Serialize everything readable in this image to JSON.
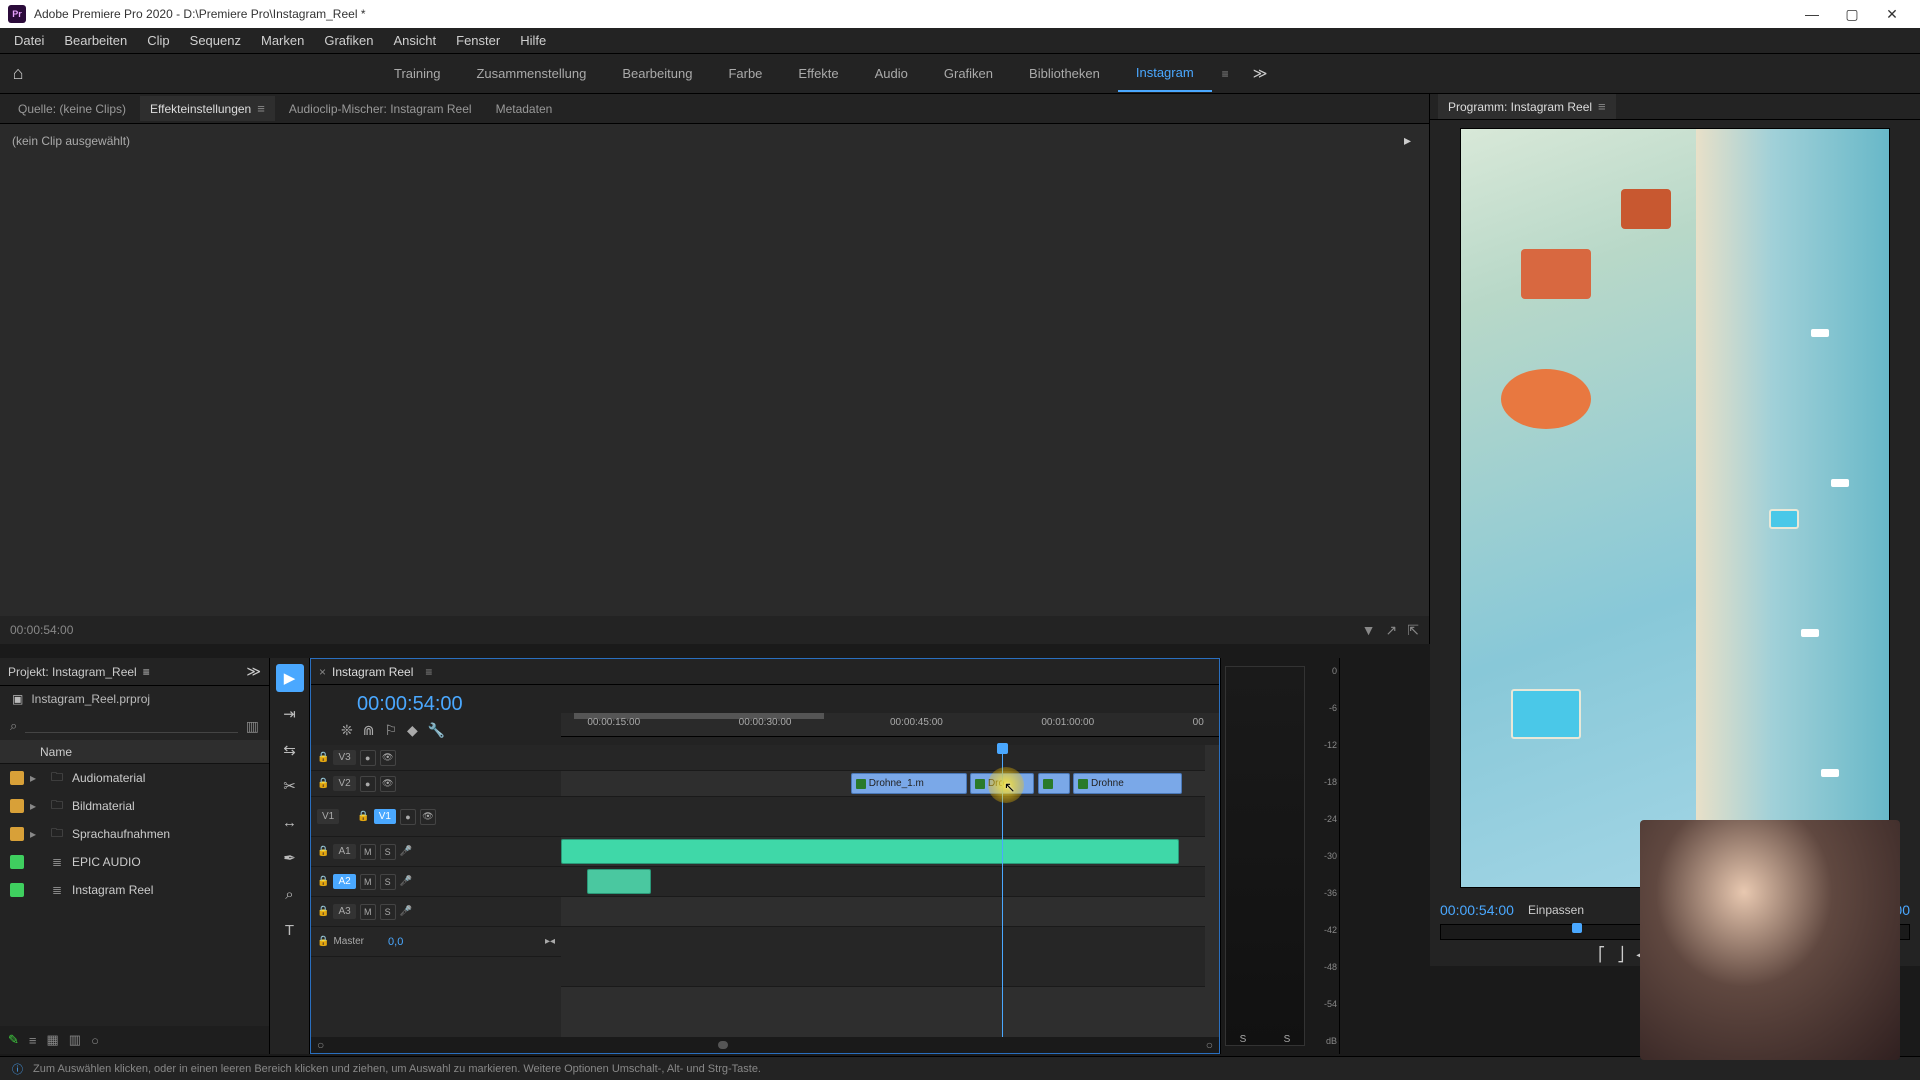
{
  "window": {
    "app_badge": "Pr",
    "title": "Adobe Premiere Pro 2020 - D:\\Premiere Pro\\Instagram_Reel *"
  },
  "menu": [
    "Datei",
    "Bearbeiten",
    "Clip",
    "Sequenz",
    "Marken",
    "Grafiken",
    "Ansicht",
    "Fenster",
    "Hilfe"
  ],
  "workspaces": {
    "items": [
      "Training",
      "Zusammenstellung",
      "Bearbeitung",
      "Farbe",
      "Effekte",
      "Audio",
      "Grafiken",
      "Bibliotheken",
      "Instagram"
    ],
    "active_index": 8
  },
  "source_panel": {
    "tabs": [
      {
        "label": "Quelle: (keine Clips)"
      },
      {
        "label": "Effekteinstellungen"
      },
      {
        "label": "Audioclip-Mischer: Instagram Reel"
      },
      {
        "label": "Metadaten"
      }
    ],
    "active_tab_index": 1,
    "empty_text": "(kein Clip ausgewählt)",
    "timecode": "00:00:54:00"
  },
  "program_panel": {
    "title": "Programm: Instagram Reel",
    "timecode": "00:00:54:00",
    "zoom": "Einpassen",
    "duration": "00:00"
  },
  "project_panel": {
    "title": "Projekt: Instagram_Reel",
    "filename": "Instagram_Reel.prproj",
    "header": "Name",
    "items": [
      {
        "label": "Audiomaterial",
        "color": "#d8a038",
        "icon": "bin"
      },
      {
        "label": "Bildmaterial",
        "color": "#d8a038",
        "icon": "bin"
      },
      {
        "label": "Sprachaufnahmen",
        "color": "#d8a038",
        "icon": "bin"
      },
      {
        "label": "EPIC AUDIO",
        "color": "#3fcf5f",
        "icon": "seq"
      },
      {
        "label": "Instagram Reel",
        "color": "#3fcf5f",
        "icon": "seq"
      }
    ]
  },
  "timeline": {
    "tab": "Instagram Reel",
    "timecode": "00:00:54:00",
    "ruler": [
      "00:00:15:00",
      "00:00:30:00",
      "00:00:45:00",
      "00:01:00:00",
      "00"
    ],
    "playhead_pct": 70,
    "video_tracks": [
      {
        "id": "V3",
        "active": false
      },
      {
        "id": "V2",
        "active": false
      },
      {
        "id": "V1",
        "active": true,
        "source": "V1"
      }
    ],
    "audio_tracks": [
      {
        "id": "A1",
        "active": false
      },
      {
        "id": "A2",
        "active": true
      },
      {
        "id": "A3",
        "active": false
      }
    ],
    "master": {
      "label": "Master",
      "value": "0,0"
    },
    "v2_clips": [
      {
        "label": "Drohne_1.m",
        "left_pct": 45,
        "width_pct": 18
      },
      {
        "label": "Dro",
        "left_pct": 63.5,
        "width_pct": 10
      },
      {
        "label": "",
        "left_pct": 74,
        "width_pct": 5
      },
      {
        "label": "Drohne",
        "left_pct": 79.5,
        "width_pct": 17
      }
    ],
    "a1_clip": {
      "left_pct": 0,
      "width_pct": 96
    },
    "a2_clip": {
      "left_pct": 4,
      "width_pct": 10
    }
  },
  "meters": {
    "scale": [
      "0",
      "-6",
      "-12",
      "-18",
      "-24",
      "-30",
      "-36",
      "-42",
      "-48",
      "-54",
      "dB"
    ],
    "solo": "S"
  },
  "status": {
    "text": "Zum Auswählen klicken, oder in einen leeren Bereich klicken und ziehen, um Auswahl zu markieren. Weitere Optionen Umschalt-, Alt- und Strg-Taste."
  }
}
